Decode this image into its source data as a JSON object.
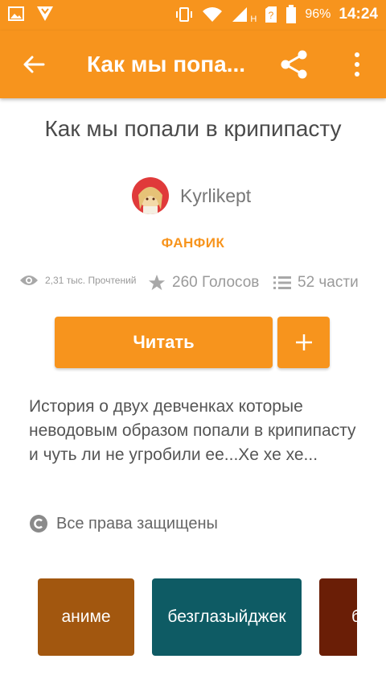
{
  "status_bar": {
    "battery_percent": "96%",
    "time": "14:24",
    "network_letter": "H"
  },
  "toolbar": {
    "title": "Как мы попа...",
    "back_icon": "arrow-left-icon",
    "share_icon": "share-icon",
    "more_icon": "more-vertical-icon"
  },
  "story": {
    "title": "Как мы попали в крипипасту",
    "author": "Kyrlikept",
    "category": "ФАНФИК",
    "reads": "2,31 тыс. Прочтений",
    "votes": "260 Голосов",
    "parts": "52 части",
    "read_button": "Читать",
    "description": "История о двух девченках которые неводовым образом попали в крипипасту и чуть ли не угробили ее...Хе хе хе...",
    "copyright": "Все права защищены"
  },
  "tags": [
    {
      "label": "аниме",
      "color": "#a2570f"
    },
    {
      "label": "безглазыйджек",
      "color": "#0e5b64"
    },
    {
      "label": "б",
      "color": "#6a1e06"
    }
  ],
  "colors": {
    "accent": "#f7941d"
  }
}
